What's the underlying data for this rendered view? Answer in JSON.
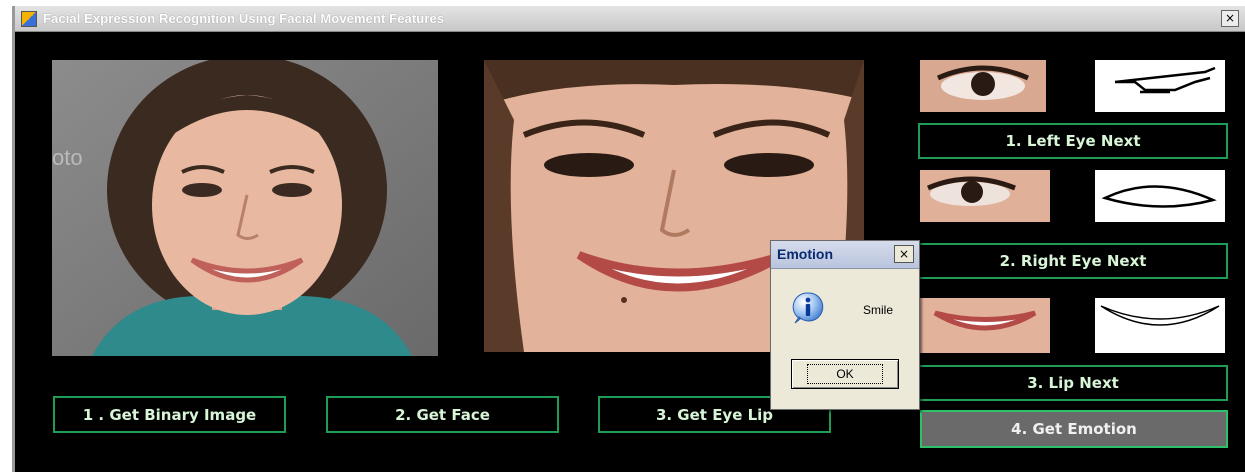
{
  "window": {
    "title": "Facial Expression Recognition Using Facial Movement Features",
    "close_glyph": "×"
  },
  "images": {
    "original": "original-face-image",
    "face_crop": "cropped-face-image",
    "left_eye": "left-eye-crop",
    "left_eye_binary": "left-eye-binary-contour",
    "right_eye": "right-eye-crop",
    "right_eye_binary": "right-eye-binary-contour",
    "lip": "lip-crop",
    "lip_binary": "lip-binary-contour"
  },
  "buttons": {
    "get_binary_image": "1 . Get Binary Image",
    "get_face": "2. Get Face",
    "get_eye_lip": "3. Get Eye Lip",
    "left_eye_next": "1.  Left Eye Next",
    "right_eye_next": "2. Right Eye Next",
    "lip_next": "3. Lip Next",
    "get_emotion": "4. Get Emotion"
  },
  "dialog": {
    "title": "Emotion",
    "close_glyph": "×",
    "icon": "info-icon",
    "message": "Smile",
    "ok_label": "OK"
  },
  "colors": {
    "button_border": "#1f9c55",
    "button_text": "#d8f5d8",
    "window_background": "#000000",
    "active_button": "#6a6a6a"
  }
}
